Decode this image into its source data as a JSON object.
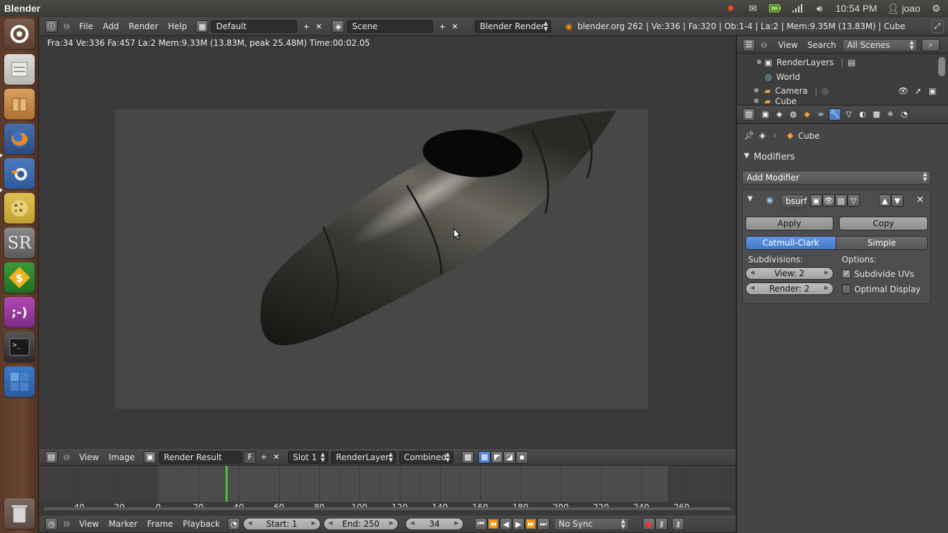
{
  "topbar": {
    "app_title": "Blender",
    "time": "10:54 PM",
    "user": "joao"
  },
  "info_header": {
    "menus": [
      "File",
      "Add",
      "Render",
      "Help"
    ],
    "screen_layout": "Default",
    "scene": "Scene",
    "engine": "Blender Render",
    "stats": "blender.org 262 | Ve:336 | Fa:320 | Ob:1-4 | La:2 | Mem:9.35M (13.83M) | Cube"
  },
  "viewport": {
    "render_info": "Fra:34  Ve:336 Fa:457 La:2 Mem:9.33M (13.83M, peak 25.48M) Time:00:02.05"
  },
  "image_header": {
    "menus": [
      "View",
      "Image"
    ],
    "image_name": "Render Result",
    "fake_user": "F",
    "slot": "Slot 1",
    "layer": "RenderLayer",
    "pass": "Combined"
  },
  "timeline": {
    "ticks": [
      "-40",
      "-20",
      "0",
      "20",
      "40",
      "60",
      "80",
      "100",
      "120",
      "140",
      "160",
      "180",
      "200",
      "220",
      "240",
      "260"
    ],
    "menus": [
      "View",
      "Marker",
      "Frame",
      "Playback"
    ],
    "start": "Start: 1",
    "end": "End: 250",
    "current": "34",
    "sync": "No Sync"
  },
  "outliner": {
    "menus": [
      "View",
      "Search"
    ],
    "filter": "All Scenes",
    "items": [
      "RenderLayers",
      "World",
      "Camera",
      "Cube"
    ]
  },
  "properties": {
    "breadcrumb": "Cube",
    "section": "Modifiers",
    "add_modifier": "Add Modifier",
    "modifier_name": "bsurf",
    "apply": "Apply",
    "copy": "Copy",
    "catmull": "Catmull-Clark",
    "simple": "Simple",
    "subdivisions_label": "Subdivisions:",
    "options_label": "Options:",
    "view_levels": "View: 2",
    "render_levels": "Render: 2",
    "subdivide_uvs": "Subdivide UVs",
    "optimal_display": "Optimal Display"
  },
  "colors": {
    "accent_blue": "#5a8cd8",
    "timeline_cursor": "#4fc43b"
  }
}
